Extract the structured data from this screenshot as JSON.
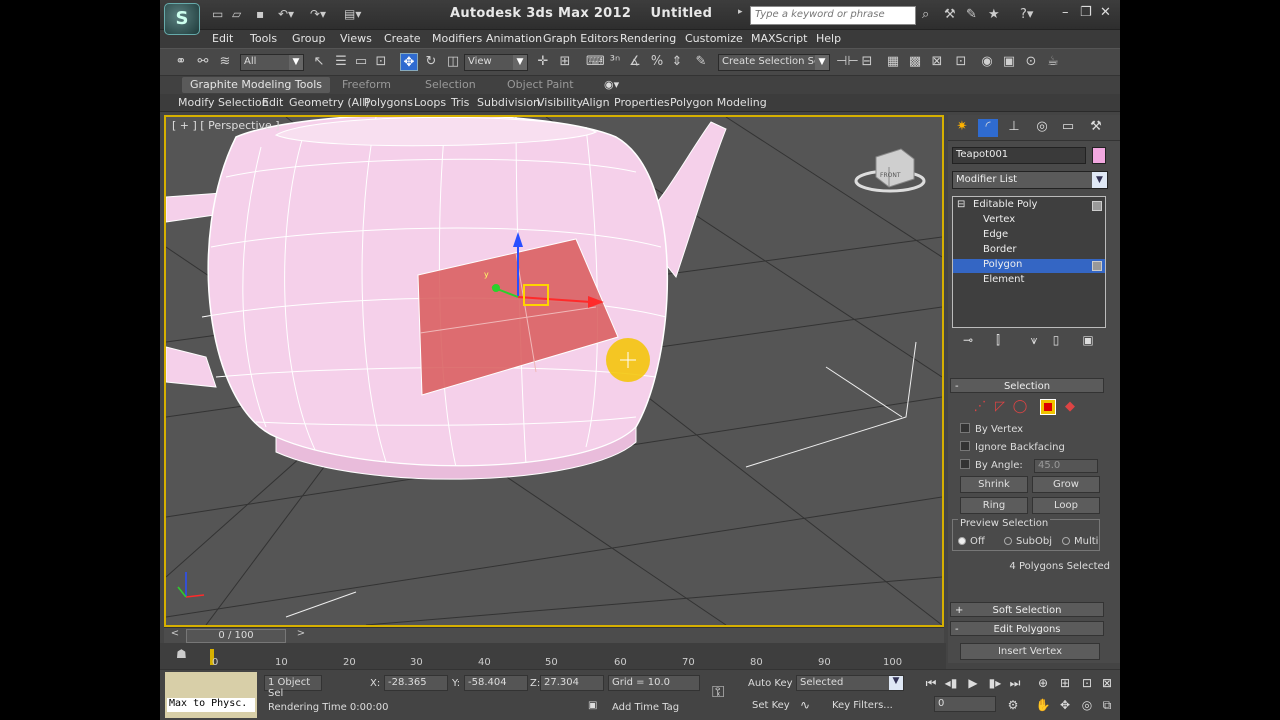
{
  "window": {
    "title": "Autodesk 3ds Max  2012",
    "document": "Untitled"
  },
  "search": {
    "placeholder": "Type a keyword or phrase"
  },
  "menu": [
    "Edit",
    "Tools",
    "Group",
    "Views",
    "Create",
    "Modifiers",
    "Animation",
    "Graph Editors",
    "Rendering",
    "Customize",
    "MAXScript",
    "Help"
  ],
  "toolbar": {
    "filter": "All",
    "ref_coord": "View",
    "named_selection": "Create Selection Se"
  },
  "ribbon": {
    "tabs": [
      "Graphite Modeling Tools",
      "Freeform",
      "Selection",
      "Object Paint"
    ],
    "items": [
      "Modify Selection",
      "Edit",
      "Geometry (All)",
      "Polygons",
      "Loops",
      "Tris",
      "Subdivision",
      "Visibility",
      "Align",
      "Properties",
      "Polygon Modeling"
    ]
  },
  "viewport": {
    "label": "[ + ] [ Perspective ]",
    "viewcube_label": "FRONT"
  },
  "command_panel": {
    "object_name": "Teapot001",
    "object_color": "#f2a8e0",
    "modifier_list": "Modifier List",
    "stack": [
      {
        "label": "Editable Poly",
        "level": 0
      },
      {
        "label": "Vertex",
        "level": 1
      },
      {
        "label": "Edge",
        "level": 1
      },
      {
        "label": "Border",
        "level": 1
      },
      {
        "label": "Polygon",
        "level": 1,
        "selected": true
      },
      {
        "label": "Element",
        "level": 1
      }
    ],
    "selection": {
      "title": "Selection",
      "by_vertex": "By Vertex",
      "ignore_backfacing": "Ignore Backfacing",
      "by_angle": "By Angle:",
      "angle_value": "45.0",
      "shrink": "Shrink",
      "grow": "Grow",
      "ring": "Ring",
      "loop": "Loop",
      "preview_title": "Preview Selection",
      "preview_off": "Off",
      "preview_subobj": "SubObj",
      "preview_multi": "Multi",
      "status": "4 Polygons Selected"
    },
    "soft_selection": "Soft Selection",
    "edit_polygons": "Edit Polygons",
    "insert_vertex": "Insert Vertex"
  },
  "timeline": {
    "frame": "0 / 100",
    "ticks": [
      "0",
      "10",
      "20",
      "30",
      "40",
      "50",
      "60",
      "70",
      "80",
      "90",
      "100"
    ]
  },
  "status": {
    "maxscript": "Max to Physc.",
    "selection": "1 Object Sel",
    "x_label": "X:",
    "x": "-28.365",
    "y_label": "Y:",
    "y": "-58.404",
    "z_label": "Z:",
    "z": "27.304",
    "grid": "Grid = 10.0",
    "rendering_time": "Rendering Time  0:00:00",
    "add_time_tag": "Add Time Tag",
    "auto_key": "Auto Key",
    "key_mode": "Selected",
    "set_key": "Set Key",
    "key_filters": "Key Filters...",
    "current_frame": "0"
  },
  "colors": {
    "selected_face": "#d85a5a",
    "teapot": "#f5d0ea",
    "accent": "#3466c4",
    "active_border": "#d6b000"
  }
}
